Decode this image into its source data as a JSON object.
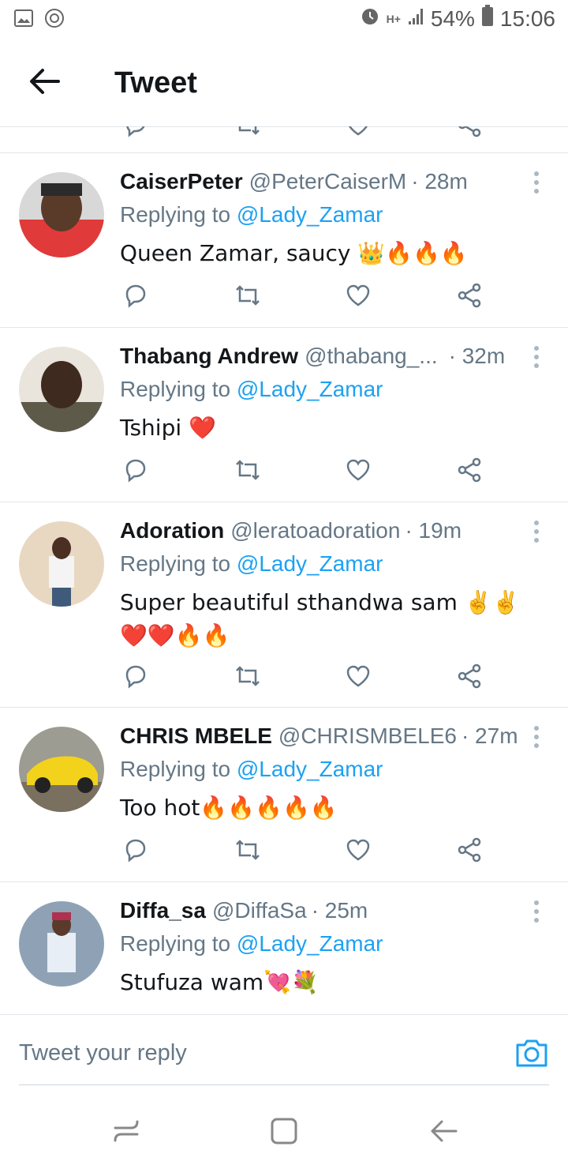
{
  "status_bar": {
    "battery": "54%",
    "time": "15:06",
    "network": "H+"
  },
  "header": {
    "title": "Tweet"
  },
  "tweets": [
    {
      "display_name": "CaiserPeter",
      "handle": "@PeterCaiserM",
      "time": "· 28m",
      "replying_prefix": "Replying to",
      "replying_to": "@Lady_Zamar",
      "text": "Queen Zamar, saucy 👑🔥🔥🔥"
    },
    {
      "display_name": "Thabang Andrew",
      "handle": "@thabang_...",
      "time": "· 32m",
      "replying_prefix": "Replying to",
      "replying_to": "@Lady_Zamar",
      "text": "Tshipi ❤️"
    },
    {
      "display_name": "Adoration",
      "handle": "@leratoadoration",
      "time": "· 19m",
      "replying_prefix": "Replying to",
      "replying_to": "@Lady_Zamar",
      "text": "Super beautiful sthandwa sam ✌️✌️❤️❤️🔥🔥"
    },
    {
      "display_name": "CHRIS MBELE",
      "handle": "@CHRISMBELE6",
      "time": "· 27m",
      "replying_prefix": "Replying to",
      "replying_to": "@Lady_Zamar",
      "text": "Too hot🔥🔥🔥🔥🔥"
    },
    {
      "display_name": "Diffa_sa",
      "handle": "@DiffaSa",
      "time": "· 25m",
      "replying_prefix": "Replying to",
      "replying_to": "@Lady_Zamar",
      "text": "Stufuza wam💘💐"
    }
  ],
  "composer": {
    "placeholder": "Tweet your reply"
  },
  "colors": {
    "accent": "#1da1f2",
    "secondary_text": "#657786",
    "divider": "#e1e6ea"
  }
}
